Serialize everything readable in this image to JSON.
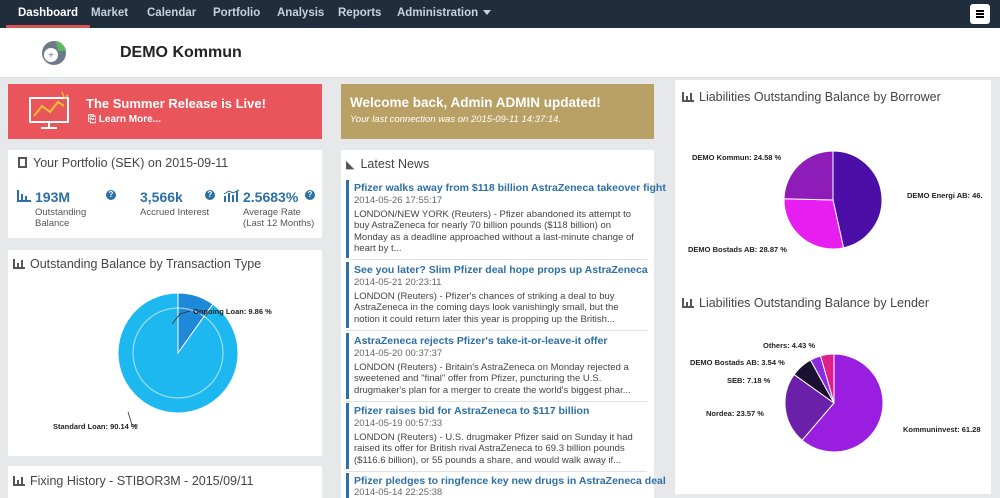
{
  "nav": {
    "items": [
      "Dashboard",
      "Market",
      "Calendar",
      "Portfolio",
      "Analysis",
      "Reports",
      "Administration"
    ],
    "active": "Dashboard"
  },
  "brand": {
    "name": "DEMO Kommun"
  },
  "promo": {
    "title": "The Summer Release is Live!",
    "link": "Learn More..."
  },
  "welcome": {
    "title": "Welcome back, Admin ADMIN updated!",
    "subtitle": "Your last connection was on 2015-09-11 14:37:14."
  },
  "portfolio": {
    "title": "Your Portfolio (SEK) on 2015-09-11",
    "stats": [
      {
        "value": "193M",
        "label": "Outstanding Balance"
      },
      {
        "value": "3,566k",
        "label": "Accrued Interest"
      },
      {
        "value": "2.5683%",
        "label": "Average Rate (Last 12 Months)"
      }
    ]
  },
  "transaction_panel": {
    "title": "Outstanding Balance by Transaction Type",
    "chart_data": {
      "type": "pie",
      "categories": [
        "Ongoing Loan",
        "Standard Loan"
      ],
      "values": [
        9.86,
        90.14
      ],
      "labels": [
        "Ongoing Loan: 9.86 %",
        "Standard Loan: 90.14 %"
      ],
      "colors": [
        "#1e88d9",
        "#1eb8f0"
      ]
    }
  },
  "fixing": {
    "title": "Fixing History - STIBOR3M - 2015/09/11"
  },
  "news": {
    "title": "Latest News",
    "items": [
      {
        "title": "Pfizer walks away from $118 billion AstraZeneca takeover fight",
        "date": "2014-05-26 17:55:17",
        "body": "LONDON/NEW YORK (Reuters) - Pfizer abandoned its attempt to buy AstraZeneca for nearly 70 billion pounds ($118 billion) on Monday as a deadline approached without a last-minute change of heart by t..."
      },
      {
        "title": "See you later? Slim Pfizer deal hope props up AstraZeneca",
        "date": "2014-05-21 20:23:11",
        "body": "LONDON (Reuters) - Pfizer's chances of striking a deal to buy AstraZeneca in the coming days look vanishingly small, but the notion it could return later this year is propping up the British..."
      },
      {
        "title": "AstraZeneca rejects Pfizer's take-it-or-leave-it offer",
        "date": "2014-05-20 00:37:37",
        "body": "LONDON (Reuters) - Britain's AstraZeneca on Monday rejected a sweetened and \"final\" offer from Pfizer, puncturing the U.S. drugmaker's plan for a merger to create the world's biggest phar..."
      },
      {
        "title": "Pfizer raises bid for AstraZeneca to $117 billion",
        "date": "2014-05-19 00:57:33",
        "body": "LONDON (Reuters) - U.S. drugmaker Pfizer said on Sunday it had raised its offer for British rival AstraZeneca to 69.3 billion pounds ($116.6 billion), or 55 pounds a share, and would walk away if..."
      },
      {
        "title": "Pfizer pledges to ringfence key new drugs in AstraZeneca deal",
        "date": "2014-05-14 22:25:38",
        "body": ""
      }
    ]
  },
  "borrower_panel": {
    "title": "Liabilities Outstanding Balance by Borrower",
    "chart_data": {
      "type": "pie",
      "categories": [
        "DEMO Energi AB",
        "DEMO Bostads AB",
        "DEMO Kommun"
      ],
      "values": [
        46.55,
        28.87,
        24.58
      ],
      "labels": [
        "DEMO Energi AB: 46.",
        "DEMO Bostads AB: 28.87 %",
        "DEMO Kommun: 24.58 %"
      ],
      "colors": [
        "#4b0fa8",
        "#e81ef0",
        "#8e1cb8"
      ]
    }
  },
  "lender_panel": {
    "title": "Liabilities Outstanding Balance by Lender",
    "chart_data": {
      "type": "pie",
      "categories": [
        "Kommuninvest",
        "Nordea",
        "SEB",
        "DEMO Bostads AB",
        "Others"
      ],
      "values": [
        61.28,
        23.57,
        7.18,
        3.54,
        4.43
      ],
      "labels": [
        "Kommuninvest: 61.28",
        "Nordea: 23.57 %",
        "SEB: 7.18 %",
        "DEMO Bostads AB: 3.54 %",
        "Others: 4.43 %"
      ],
      "colors": [
        "#9a1ee0",
        "#6a20a8",
        "#1a1030",
        "#8a2be2",
        "#e0208a"
      ]
    }
  }
}
